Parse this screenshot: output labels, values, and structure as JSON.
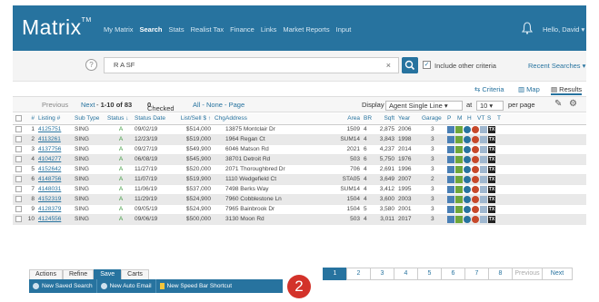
{
  "app": {
    "logo": "Matrix",
    "logo_tm": "TM",
    "nav": [
      "My Matrix",
      "Search",
      "Stats",
      "Realist Tax",
      "Finance",
      "Links",
      "Market Reports",
      "Input"
    ],
    "nav_active": "Search",
    "user_greeting": "Hello, David ▾"
  },
  "search": {
    "value": "R A SF",
    "clear": "×",
    "include_other_label": "Include other criteria",
    "include_other_checked": true,
    "recent_label": "Recent Searches ▾"
  },
  "views": {
    "criteria": "Criteria",
    "map": "Map",
    "results": "Results",
    "active": "Results"
  },
  "results_header": {
    "previous": "Previous",
    "next": "Next",
    "range": "1-10 of 83",
    "checked_label": "Checked",
    "checked_count": "0",
    "all_none_page": "All - None - Page",
    "display_label": "Display",
    "display_value": "Agent Single Line ▾",
    "at_label": "at",
    "per_page_value": "10 ▾",
    "per_page_label": "per page"
  },
  "table": {
    "columns": [
      "",
      "#",
      "Listing #",
      "Sub Type",
      "Status ↓",
      "Status Date",
      "List/Sell $ ↑",
      "Chg",
      "Address",
      "Area",
      "BR",
      "Sqft",
      "Year",
      "Garage",
      "P",
      "M",
      "H",
      "VT",
      "S",
      "T"
    ],
    "rows": [
      {
        "n": "1",
        "listing": "4125751",
        "sub": "SING",
        "status": "A",
        "date": "09/02/19",
        "price": "$514,000",
        "address": "13875 Montclair Dr",
        "area": "1509",
        "br": "4",
        "sqft": "2,875",
        "year": "2006",
        "garage": "3"
      },
      {
        "n": "2",
        "listing": "4113261",
        "sub": "SING",
        "status": "A",
        "date": "12/23/19",
        "price": "$519,000",
        "address": "1964 Regan Ct",
        "area": "SUM14",
        "br": "4",
        "sqft": "3,843",
        "year": "1998",
        "garage": "3"
      },
      {
        "n": "3",
        "listing": "4137756",
        "sub": "SING",
        "status": "A",
        "date": "09/27/19",
        "price": "$549,900",
        "address": "6046 Matson Rd",
        "area": "2021",
        "br": "6",
        "sqft": "4,237",
        "year": "2014",
        "garage": "3"
      },
      {
        "n": "4",
        "listing": "4104277",
        "sub": "SING",
        "status": "A",
        "date": "06/08/19",
        "price": "$545,900",
        "address": "38701 Detroit Rd",
        "area": "503",
        "br": "6",
        "sqft": "5,750",
        "year": "1976",
        "garage": "3"
      },
      {
        "n": "5",
        "listing": "4152642",
        "sub": "SING",
        "status": "A",
        "date": "11/27/19",
        "price": "$520,000",
        "address": "2071 Thoroughbred Dr",
        "area": "706",
        "br": "4",
        "sqft": "2,691",
        "year": "1996",
        "garage": "3"
      },
      {
        "n": "6",
        "listing": "4148756",
        "sub": "SING",
        "status": "A",
        "date": "11/07/19",
        "price": "$519,900",
        "address": "1110 Wedgefield Ct",
        "area": "STA05",
        "br": "4",
        "sqft": "3,649",
        "year": "2007",
        "garage": "2"
      },
      {
        "n": "7",
        "listing": "4148031",
        "sub": "SING",
        "status": "A",
        "date": "11/06/19",
        "price": "$537,000",
        "address": "7498 Berks Way",
        "area": "SUM14",
        "br": "4",
        "sqft": "3,412",
        "year": "1995",
        "garage": "3"
      },
      {
        "n": "8",
        "listing": "4152319",
        "sub": "SING",
        "status": "A",
        "date": "11/29/19",
        "price": "$524,900",
        "address": "7960 Cobblestone Ln",
        "area": "1504",
        "br": "4",
        "sqft": "3,600",
        "year": "2003",
        "garage": "3"
      },
      {
        "n": "9",
        "listing": "4128379",
        "sub": "SING",
        "status": "A",
        "date": "09/05/19",
        "price": "$524,900",
        "address": "7965 Bainbrook Dr",
        "area": "1504",
        "br": "5",
        "sqft": "3,580",
        "year": "2001",
        "garage": "3"
      },
      {
        "n": "10",
        "listing": "4124556",
        "sub": "SING",
        "status": "A",
        "date": "09/06/19",
        "price": "$500,000",
        "address": "3130 Moon Rd",
        "area": "503",
        "br": "4",
        "sqft": "3,011",
        "year": "2017",
        "garage": "3"
      }
    ]
  },
  "bottom": {
    "tabs": [
      "Actions",
      "Refine",
      "Save",
      "Carts"
    ],
    "active_tab": "Save",
    "actions": [
      "New Saved Search",
      "New Auto Email",
      "New Speed Bar Shortcut"
    ],
    "badge": "2"
  },
  "pager": {
    "pages": [
      "1",
      "2",
      "3",
      "4",
      "5",
      "6",
      "7",
      "8"
    ],
    "active": "1",
    "previous": "Previous",
    "next": "Next"
  },
  "colors": {
    "brand": "#27739f",
    "badge": "#d3322a",
    "active_status": "#3a9a3a"
  },
  "icons": [
    "help-icon",
    "search-icon",
    "bell-icon",
    "criteria-icon",
    "map-icon",
    "results-icon",
    "edit-icon",
    "settings-icon"
  ]
}
